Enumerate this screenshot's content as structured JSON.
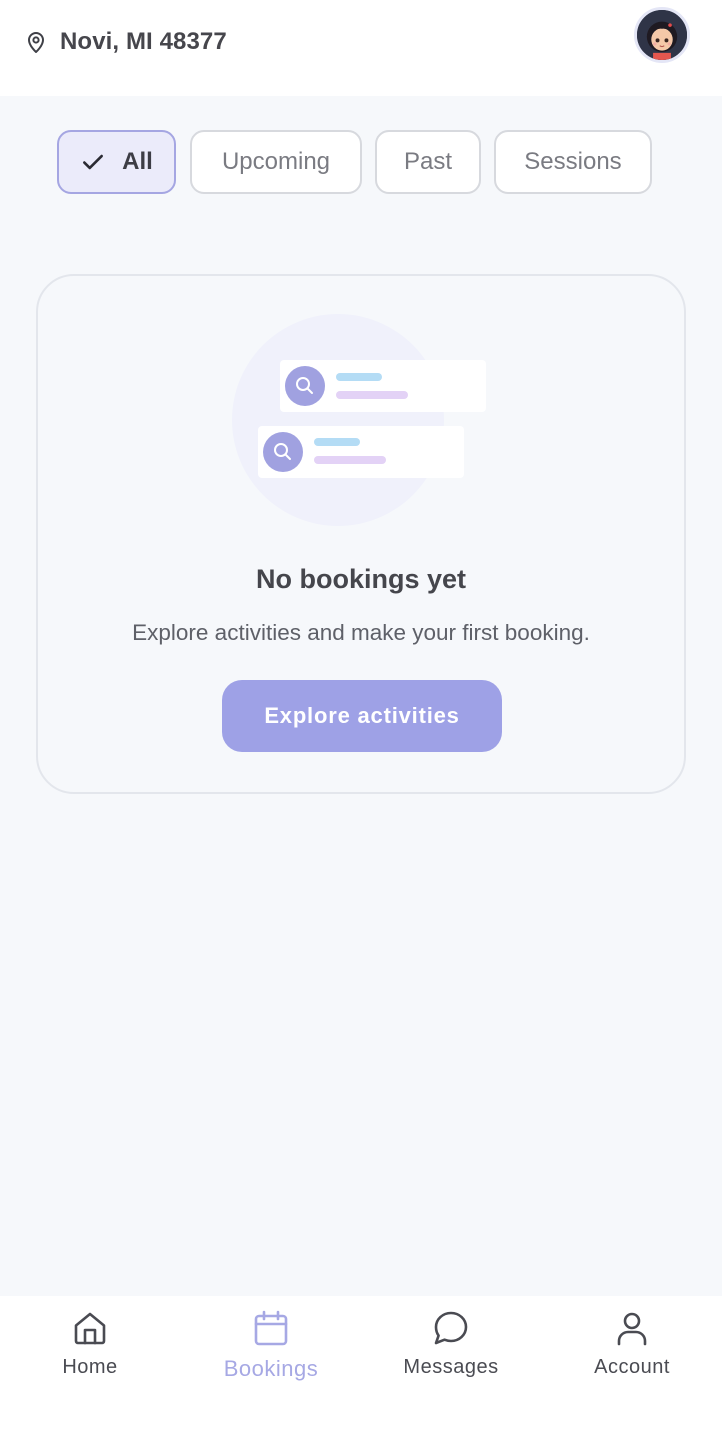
{
  "header": {
    "location": "Novi, MI 48377",
    "location_icon": "map-pin-icon",
    "avatar": "user-avatar"
  },
  "filters": {
    "selected": "All",
    "items": [
      {
        "label": "All",
        "active": true,
        "icon": "check-icon"
      },
      {
        "label": "Upcoming",
        "active": false
      },
      {
        "label": "Past",
        "active": false
      },
      {
        "label": "Sessions",
        "active": false
      }
    ]
  },
  "empty_state": {
    "illustration": "search-results-illustration",
    "title": "No bookings yet",
    "subtitle": "Explore activities and make your first booking.",
    "button_label": "Explore activities"
  },
  "bottom_nav": {
    "active": "Bookings",
    "items": [
      {
        "label": "Home",
        "icon": "home-icon"
      },
      {
        "label": "Bookings",
        "icon": "calendar-icon"
      },
      {
        "label": "Messages",
        "icon": "chat-bubble-icon"
      },
      {
        "label": "Account",
        "icon": "user-icon"
      }
    ]
  },
  "colors": {
    "accent": "#9ea1e6",
    "chip_active_bg": "#ebebfa",
    "chip_active_border": "#a5a6e2",
    "background": "#f6f8fb",
    "nav_active": "#a6a8e4"
  }
}
